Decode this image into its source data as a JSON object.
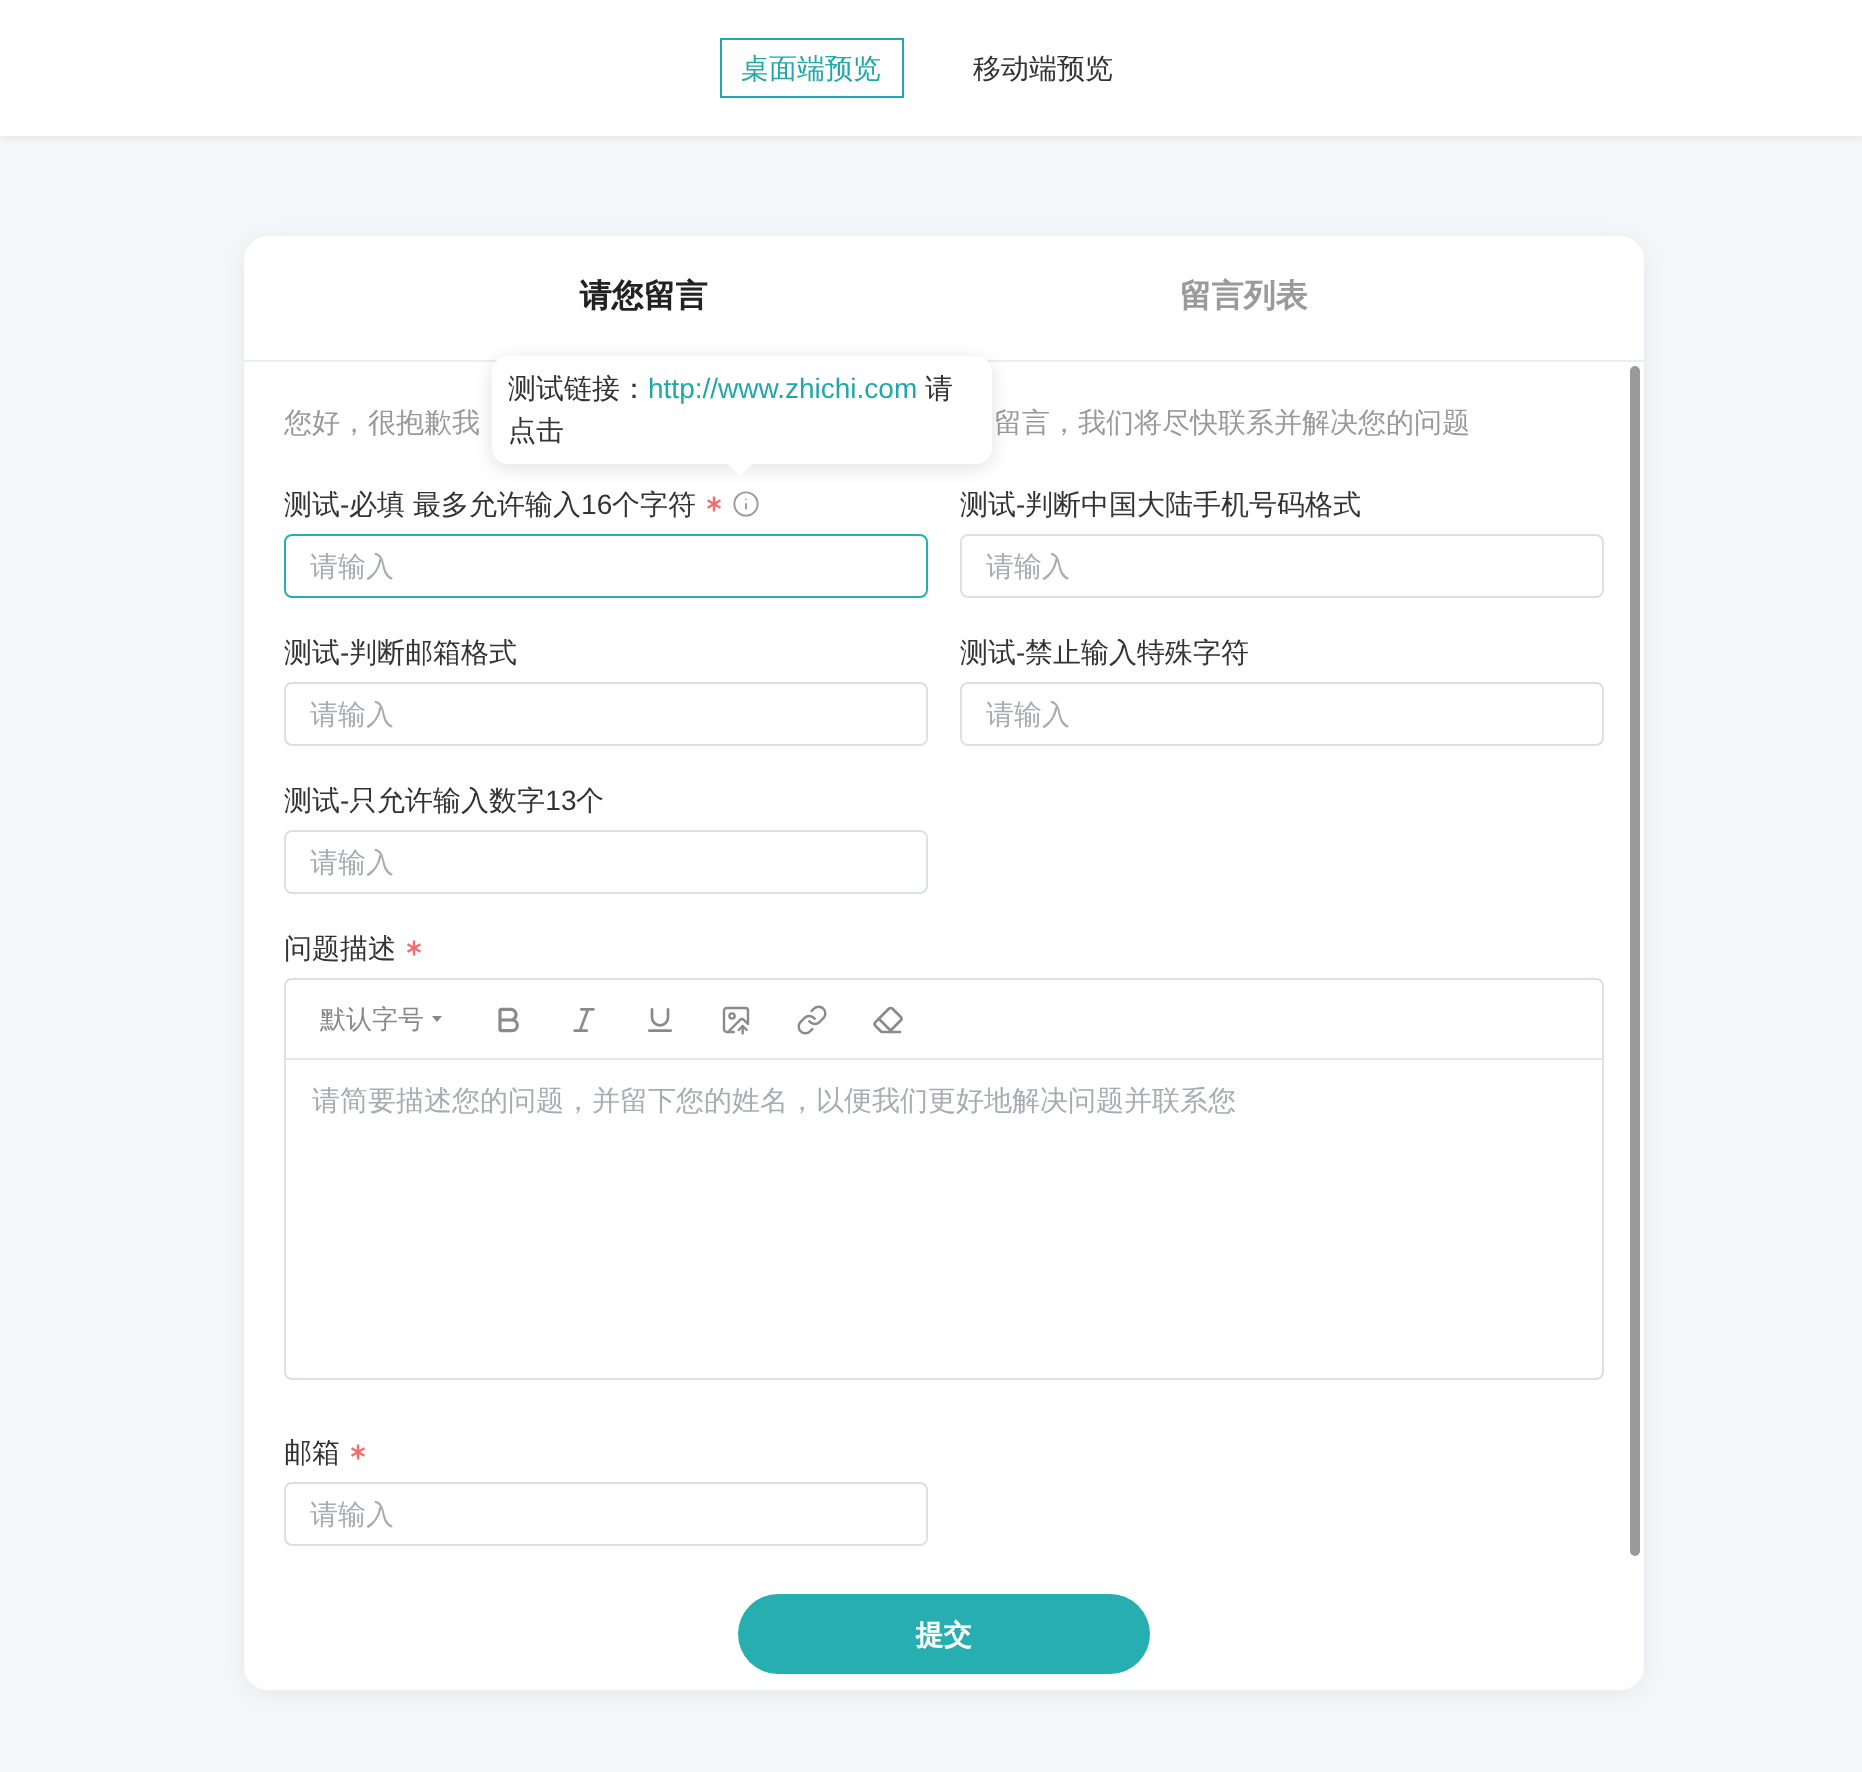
{
  "header": {
    "view_tabs": [
      {
        "label": "桌面端预览",
        "selected": true
      },
      {
        "label": "移动端预览",
        "selected": false
      }
    ]
  },
  "card": {
    "tabs": [
      {
        "label": "请您留言",
        "selected": true
      },
      {
        "label": "留言列表",
        "selected": false
      }
    ],
    "tooltip": {
      "text": "测试链接：",
      "link": "http://www.zhichi.com",
      "text_after": "请点击"
    },
    "intro": {
      "start": "您好，很抱歉我",
      "end": "留言，我们将尽快联系并解决您的问题"
    },
    "fields": [
      {
        "kind": "input",
        "label": "测试-必填 最多允许输入16个字符",
        "required": true,
        "info": true,
        "focused": true,
        "placeholder": "请输入"
      },
      {
        "kind": "input",
        "label": "测试-判断中国大陆手机号码格式",
        "required": false,
        "info": false,
        "focused": false,
        "placeholder": "请输入"
      },
      {
        "kind": "input",
        "label": "测试-判断邮箱格式",
        "required": false,
        "info": false,
        "focused": false,
        "placeholder": "请输入"
      },
      {
        "kind": "input",
        "label": "测试-禁止输入特殊字符",
        "required": false,
        "info": false,
        "focused": false,
        "placeholder": "请输入"
      },
      {
        "kind": "input",
        "label": "测试-只允许输入数字13个",
        "required": false,
        "info": false,
        "focused": false,
        "placeholder": "请输入"
      },
      {
        "kind": "editor",
        "label": "问题描述",
        "required": true,
        "info": false,
        "focused": false,
        "font_size": "默认字号",
        "placeholder": "请简要描述您的问题，并留下您的姓名，以便我们更好地解决问题并联系您"
      },
      {
        "kind": "input",
        "label": "邮箱",
        "required": true,
        "info": false,
        "focused": false,
        "placeholder": "请输入"
      }
    ],
    "submit_button": "提交"
  }
}
